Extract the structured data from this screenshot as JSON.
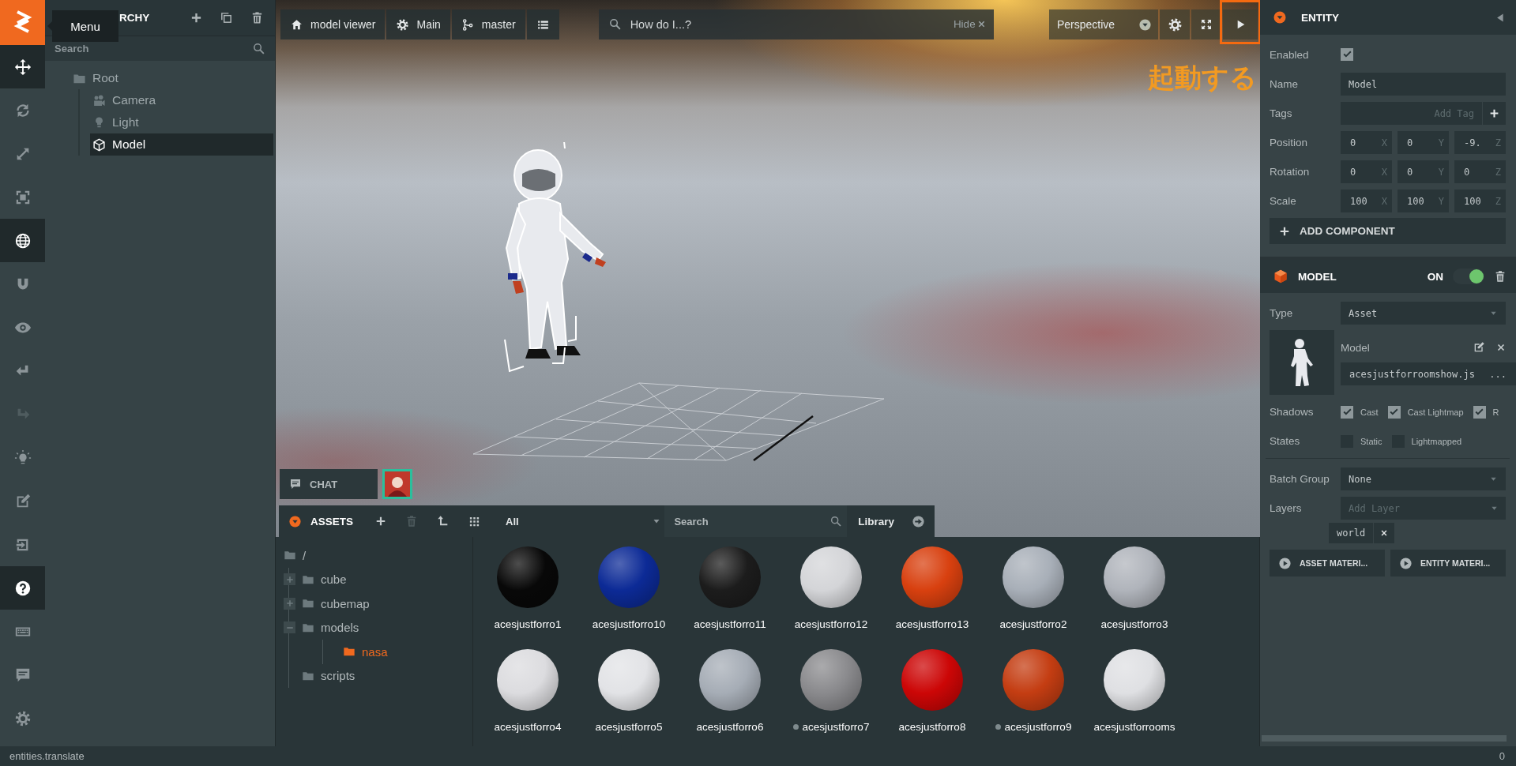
{
  "toolbar": {
    "tooltip": "Menu",
    "tools": [
      {
        "kind": "move",
        "selected": true,
        "disabled": false
      },
      {
        "kind": "rotate",
        "selected": false,
        "disabled": false
      },
      {
        "kind": "scale",
        "selected": false,
        "disabled": false
      },
      {
        "kind": "resize",
        "selected": false,
        "disabled": false
      },
      {
        "kind": "world",
        "selected": true,
        "disabled": false
      },
      {
        "kind": "snap",
        "selected": false,
        "disabled": false
      },
      {
        "kind": "focus",
        "selected": false,
        "disabled": false
      },
      {
        "kind": "undo",
        "selected": false,
        "disabled": false
      },
      {
        "kind": "redo",
        "selected": false,
        "disabled": true
      },
      {
        "kind": "lightmap",
        "selected": false,
        "disabled": false
      },
      {
        "kind": "edit",
        "selected": false,
        "disabled": false
      },
      {
        "kind": "publish",
        "selected": false,
        "disabled": false
      },
      {
        "kind": "help",
        "selected": true,
        "disabled": false
      },
      {
        "kind": "shortcuts",
        "selected": false,
        "disabled": false
      },
      {
        "kind": "feedback",
        "selected": false,
        "disabled": false
      },
      {
        "kind": "settings",
        "selected": false,
        "disabled": false
      }
    ]
  },
  "hierarchy": {
    "title": "RCHY",
    "search": {
      "placeholder": "Search"
    },
    "tree": [
      {
        "label": "Root",
        "kind": "folder",
        "selected": false,
        "children": [
          {
            "label": "Camera",
            "kind": "camera",
            "selected": false
          },
          {
            "label": "Light",
            "kind": "light",
            "selected": false
          },
          {
            "label": "Model",
            "kind": "model",
            "selected": true
          }
        ]
      }
    ]
  },
  "viewport": {
    "toolbar": [
      {
        "kind": "project",
        "label": "model viewer"
      },
      {
        "kind": "scene",
        "label": "Main"
      },
      {
        "kind": "branch",
        "label": "master"
      },
      {
        "kind": "list"
      }
    ],
    "help_search": {
      "placeholder": "How do I...?",
      "hide_label": "Hide"
    },
    "camera": {
      "label": "Perspective"
    },
    "annotation": {
      "text": "起動する"
    },
    "chat": {
      "label": "CHAT"
    }
  },
  "assets": {
    "title": "ASSETS",
    "filter": "All",
    "search": {
      "placeholder": "Search"
    },
    "library": "Library",
    "folders": [
      {
        "label": "/",
        "selected": false,
        "children": [
          {
            "label": "cube",
            "selected": false,
            "expanded": false
          },
          {
            "label": "cubemap",
            "selected": false,
            "expanded": false
          },
          {
            "label": "models",
            "selected": false,
            "expanded": true,
            "children": [
              {
                "label": "nasa",
                "selected": true
              }
            ]
          },
          {
            "label": "scripts",
            "selected": false
          }
        ]
      }
    ],
    "items": [
      {
        "label": "acesjustforro1",
        "color": "#080808",
        "dot": false
      },
      {
        "label": "acesjustforro10",
        "color": "#0c2a96",
        "dot": false
      },
      {
        "label": "acesjustforro11",
        "color": "#1c1c1c",
        "dot": false
      },
      {
        "label": "acesjustforro12",
        "color": "#d4d5d8",
        "dot": false
      },
      {
        "label": "acesjustforro13",
        "color": "#d8400f",
        "dot": false
      },
      {
        "label": "acesjustforro2",
        "color": "#a8afb8",
        "dot": false
      },
      {
        "label": "acesjustforro3",
        "color": "#b0b4bb",
        "dot": false
      },
      {
        "label": "acesjustforro4",
        "color": "#dcdcdf",
        "dot": false
      },
      {
        "label": "acesjustforro5",
        "color": "#e2e3e6",
        "dot": false
      },
      {
        "label": "acesjustforro6",
        "color": "#a6adb6",
        "dot": false
      },
      {
        "label": "acesjustforro7",
        "color": "#8a8a8d",
        "dot": true
      },
      {
        "label": "acesjustforro8",
        "color": "#cc0606",
        "dot": false
      },
      {
        "label": "acesjustforro9",
        "color": "#c43d12",
        "dot": true
      },
      {
        "label": "acesjustforrooms",
        "color": "#dfe0e3",
        "dot": false
      }
    ]
  },
  "inspector": {
    "entity": {
      "title": "ENTITY",
      "enabled": {
        "label": "Enabled",
        "checked": true
      },
      "name": {
        "label": "Name",
        "value": "Model"
      },
      "tags": {
        "label": "Tags",
        "placeholder": "Add Tag"
      },
      "vectors": [
        {
          "label": "Position",
          "values": [
            {
              "value": "0",
              "axis": "X"
            },
            {
              "value": "0",
              "axis": "Y"
            },
            {
              "value": "-9.",
              "axis": "Z"
            }
          ]
        },
        {
          "label": "Rotation",
          "values": [
            {
              "value": "0",
              "axis": "X"
            },
            {
              "value": "0",
              "axis": "Y"
            },
            {
              "value": "0",
              "axis": "Z"
            }
          ]
        },
        {
          "label": "Scale",
          "values": [
            {
              "value": "100",
              "axis": "X"
            },
            {
              "value": "100",
              "axis": "Y"
            },
            {
              "value": "100",
              "axis": "Z"
            }
          ]
        }
      ],
      "add_component": "ADD COMPONENT"
    },
    "model": {
      "title": "MODEL",
      "on_label": "ON",
      "on": true,
      "type": {
        "label": "Type",
        "value": "Asset"
      },
      "asset": {
        "label": "Model",
        "file": "acesjustforroomshow.js",
        "more": "..."
      },
      "shadows": {
        "label": "Shadows",
        "options": [
          {
            "label": "Cast",
            "checked": true
          },
          {
            "label": "Cast Lightmap",
            "checked": true
          },
          {
            "label": "R",
            "checked": true
          }
        ]
      },
      "states": {
        "label": "States",
        "options": [
          {
            "label": "Static",
            "checked": false
          },
          {
            "label": "Lightmapped",
            "checked": false
          }
        ]
      },
      "batch_group": {
        "label": "Batch Group",
        "value": "None"
      },
      "layers": {
        "label": "Layers",
        "placeholder": "Add Layer",
        "tags": [
          "world"
        ]
      },
      "buttons": [
        "ASSET MATERI...",
        "ENTITY MATERI..."
      ]
    }
  },
  "status_bar": {
    "text": "entities.translate",
    "count": "0"
  }
}
